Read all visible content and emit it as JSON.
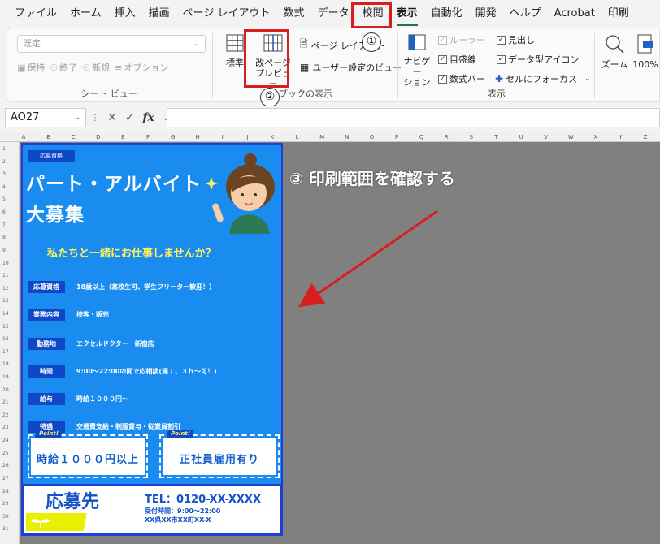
{
  "menu": {
    "items": [
      "ファイル",
      "ホーム",
      "挿入",
      "描画",
      "ページ レイアウト",
      "数式",
      "データ",
      "校閲",
      "表示",
      "自動化",
      "開発",
      "ヘルプ",
      "Acrobat",
      "印刷"
    ],
    "active_index": 8
  },
  "ribbon": {
    "sheet_view": {
      "select_value": "既定",
      "keep": "保持",
      "exit": "終了",
      "new": "新規",
      "options": "オプション",
      "label": "シート ビュー"
    },
    "workbook_views": {
      "normal": "標準",
      "page_break_line1": "改ページ",
      "page_break_line2": "プレビュー",
      "page_layout": "ページ レイアウト",
      "custom_views": "ユーザー設定のビュー",
      "label": "ブックの表示"
    },
    "show": {
      "navigation_line1": "ナビゲー",
      "navigation_line2": "ション",
      "ruler": "ルーラー",
      "gridlines": "目盛線",
      "formula_bar": "数式バー",
      "headings": "見出し",
      "data_type_icons": "データ型アイコン",
      "focus_cell": "セルにフォーカス",
      "label": "表示"
    },
    "zoom": {
      "zoom": "ズーム",
      "hundred": "100%"
    }
  },
  "annotations": {
    "step1": "①",
    "step2": "②",
    "step3": "③ 印刷範囲を確認する"
  },
  "formula_bar": {
    "name_box": "AO27",
    "fx": "fx"
  },
  "columns": [
    "A",
    "B",
    "C",
    "D",
    "E",
    "F",
    "G",
    "H",
    "I",
    "J",
    "K",
    "L",
    "M",
    "N",
    "O",
    "P",
    "Q",
    "R",
    "S",
    "T",
    "U",
    "V",
    "W",
    "X",
    "Y",
    "Z"
  ],
  "rows": [
    "1",
    "2",
    "3",
    "4",
    "5",
    "6",
    "7",
    "8",
    "9",
    "10",
    "11",
    "12",
    "13",
    "14",
    "15",
    "16",
    "17",
    "18",
    "19",
    "20",
    "21",
    "22",
    "23",
    "24",
    "25",
    "26",
    "27",
    "28",
    "29",
    "30",
    "31"
  ],
  "flyer": {
    "stamp": "応募資格",
    "headline1": "パート・アルバイト",
    "headline2": "大募集",
    "tagline": "私たちと一緒にお仕事しませんか？",
    "rows": [
      {
        "label": "応募資格",
        "value": "18歳以上（高校生可、学生フリーター歓迎！）"
      },
      {
        "label": "業務内容",
        "value": "接客・販売"
      },
      {
        "label": "勤務地",
        "value": "エクセルドクター　新宿店"
      },
      {
        "label": "時間",
        "value": "9:00～22:00の間で応相談(週１、３ｈ～可！)"
      },
      {
        "label": "給与",
        "value": "時給１０００円～"
      },
      {
        "label": "待遇",
        "value": "交通費支給・制服貸与・従業員割引"
      }
    ],
    "point_badge": "Point!",
    "point1": "時給１０００円以上",
    "point2": "正社員雇用有り",
    "contact_title": "応募先",
    "tel": "TEL：0120-XX-XXXX",
    "hours": "受付時間：9:00～22:00",
    "address": "XX県XX市XX町XX-X"
  }
}
